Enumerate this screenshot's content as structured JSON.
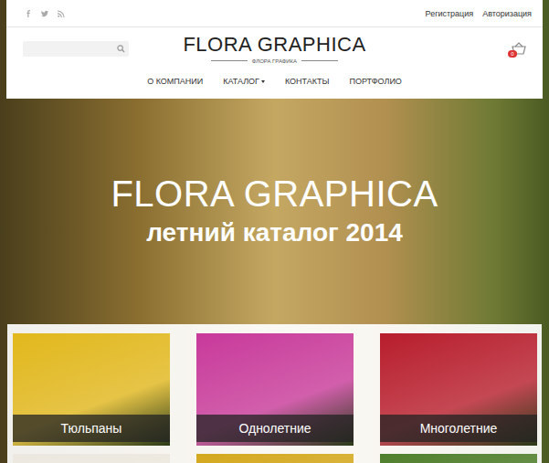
{
  "auth_links": [
    {
      "label": "Регистрация"
    },
    {
      "label": "Авторизация"
    }
  ],
  "logo": {
    "title": "FLORA GRAPHICA",
    "subtitle": "ФЛОРА ГРАФИКА"
  },
  "cart": {
    "count": "0"
  },
  "nav": [
    {
      "label": "О КОМПАНИИ",
      "dropdown": false
    },
    {
      "label": "КАТАЛОГ",
      "dropdown": true
    },
    {
      "label": "КОНТАКТЫ",
      "dropdown": false
    },
    {
      "label": "ПОРТФОЛИО",
      "dropdown": false
    }
  ],
  "hero": {
    "title": "FLORA GRAPHICA",
    "subtitle": "летний каталог 2014"
  },
  "categories": [
    {
      "label": "Тюльпаны",
      "color": "#e2b81c"
    },
    {
      "label": "Однолетние",
      "color": "#c8399a"
    },
    {
      "label": "Многолетние",
      "color": "#b81d2c"
    },
    {
      "color": "#ece8df"
    },
    {
      "color": "#d4a81e"
    },
    {
      "color": "#4f7f2c"
    }
  ]
}
